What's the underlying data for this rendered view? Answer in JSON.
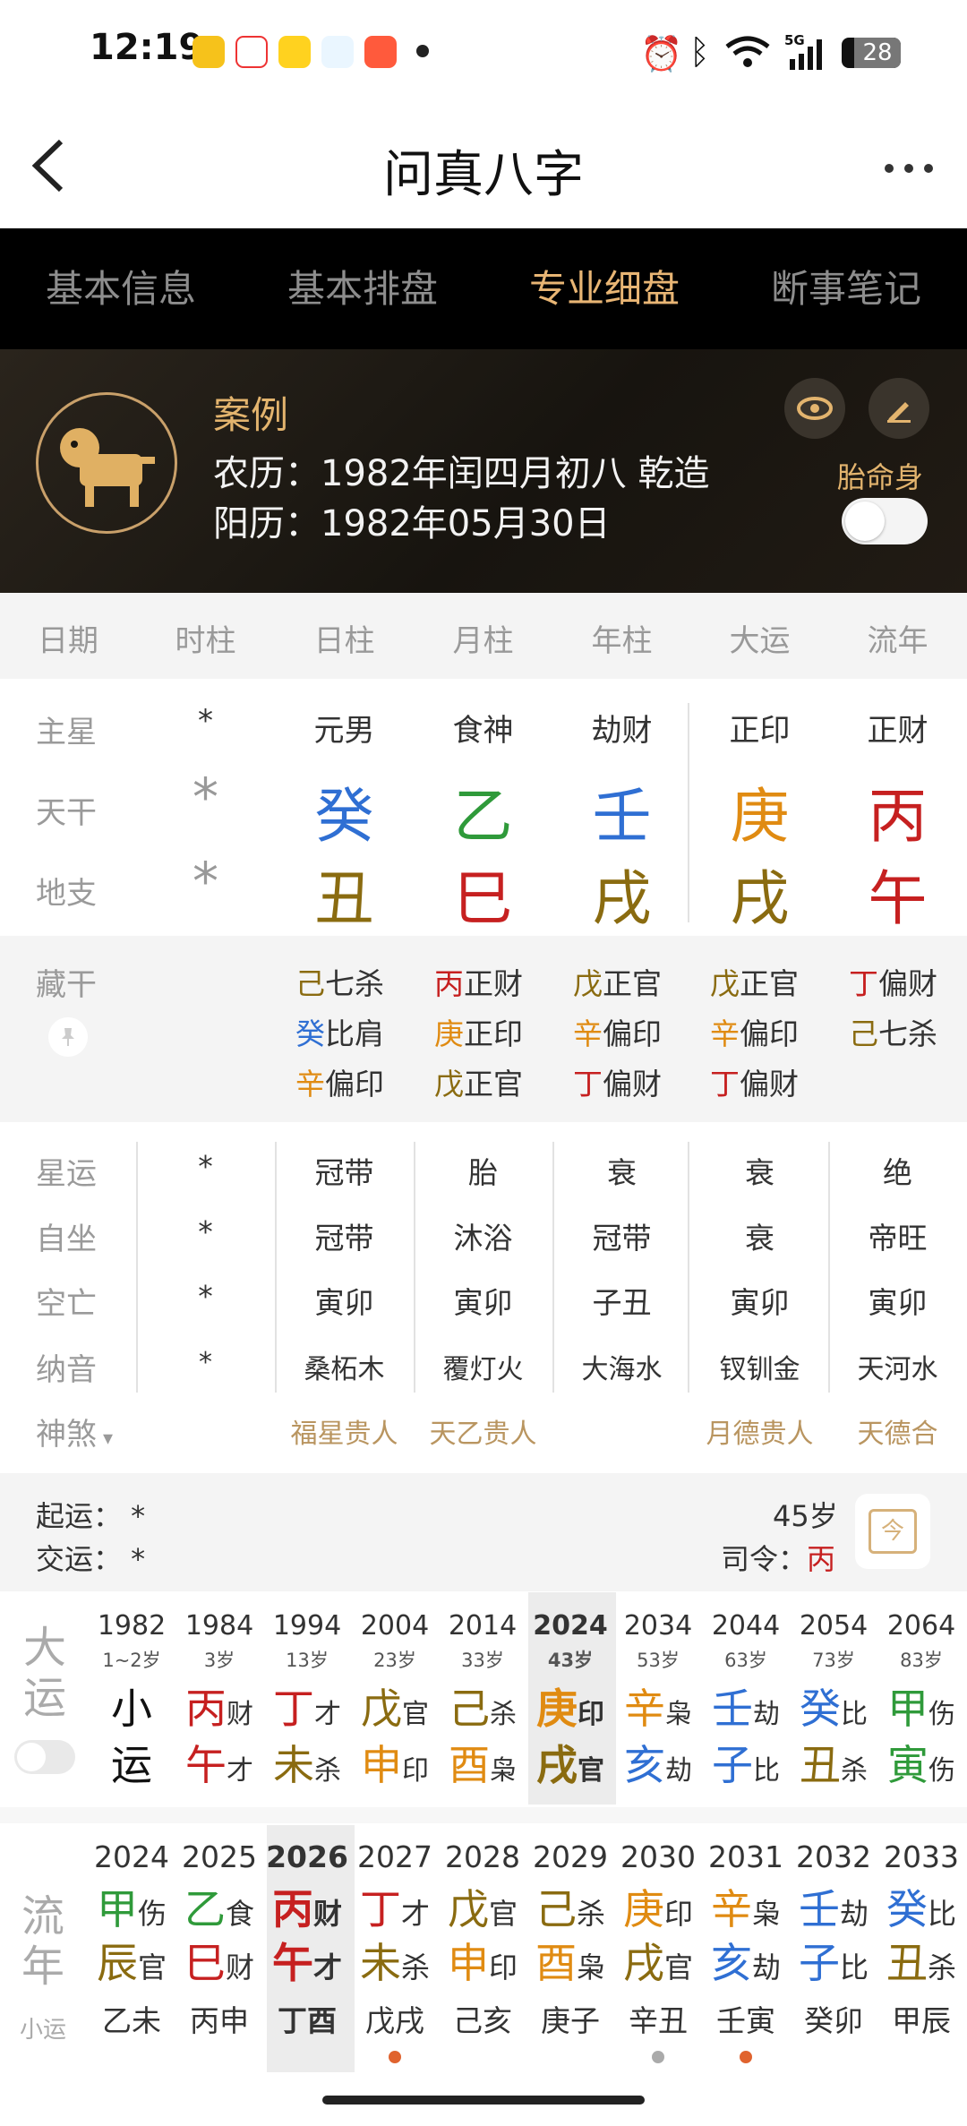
{
  "status_bar": {
    "time": "12:19",
    "battery": "28",
    "network": "5G"
  },
  "header": {
    "title": "问真八字",
    "back_icon": "chevron-left-icon",
    "more_icon": "more-icon"
  },
  "tabs": [
    "基本信息",
    "基本排盘",
    "专业细盘",
    "断事笔记"
  ],
  "active_tab": 2,
  "profile": {
    "name": "案例",
    "lunar": "农历：1982年闰四月初八 乾造",
    "solar": "阳历：1982年05月30日",
    "taiming_label": "胎命身",
    "taiming_on": false
  },
  "grid": {
    "headers": [
      "日期",
      "时柱",
      "日柱",
      "月柱",
      "年柱",
      "大运",
      "流年"
    ],
    "rows": {
      "zhuxing": {
        "label": "主星",
        "values": [
          "*",
          "元男",
          "食神",
          "劫财",
          "正印",
          "正财"
        ]
      },
      "tiangan": {
        "label": "天干",
        "values": [
          "*",
          "癸",
          "乙",
          "壬",
          "庚",
          "丙"
        ]
      },
      "dizhi": {
        "label": "地支",
        "values": [
          "*",
          "丑",
          "巳",
          "戌",
          "戌",
          "午"
        ]
      }
    }
  },
  "canggan": {
    "label": "藏干",
    "columns": [
      [
        {
          "g": "己",
          "t": "七杀"
        },
        {
          "g": "癸",
          "t": "比肩"
        },
        {
          "g": "辛",
          "t": "偏印"
        }
      ],
      [
        {
          "g": "丙",
          "t": "正财"
        },
        {
          "g": "庚",
          "t": "正印"
        },
        {
          "g": "戊",
          "t": "正官"
        }
      ],
      [
        {
          "g": "戊",
          "t": "正官"
        },
        {
          "g": "辛",
          "t": "偏印"
        },
        {
          "g": "丁",
          "t": "偏财"
        }
      ],
      [
        {
          "g": "戊",
          "t": "正官"
        },
        {
          "g": "辛",
          "t": "偏印"
        },
        {
          "g": "丁",
          "t": "偏财"
        }
      ],
      [
        {
          "g": "丁",
          "t": "偏财"
        },
        {
          "g": "己",
          "t": "七杀"
        }
      ]
    ]
  },
  "details": {
    "xingyun": {
      "label": "星运",
      "values": [
        "*",
        "冠带",
        "胎",
        "衰",
        "衰",
        "绝"
      ]
    },
    "zizuo": {
      "label": "自坐",
      "values": [
        "*",
        "冠带",
        "沐浴",
        "冠带",
        "衰",
        "帝旺"
      ]
    },
    "kongwang": {
      "label": "空亡",
      "values": [
        "*",
        "寅卯",
        "寅卯",
        "子丑",
        "寅卯",
        "寅卯"
      ]
    },
    "nayin": {
      "label": "纳音",
      "values": [
        "*",
        "桑柘木",
        "覆灯火",
        "大海水",
        "钗钏金",
        "天河水"
      ]
    },
    "shensha": {
      "label": "神煞",
      "values": [
        "",
        "福星贵人",
        "天乙贵人",
        "",
        "月德贵人",
        "天德合"
      ]
    }
  },
  "qiyun": {
    "start": "起运：  *",
    "jiao": "交运：  *",
    "age": "45岁",
    "siling_label": "司令：",
    "siling_value": "丙",
    "calendar_icon": "calendar-today-icon",
    "calendar_text": "今"
  },
  "dayun": {
    "label_top": "大",
    "label_bottom": "运",
    "items": [
      {
        "year": "1982",
        "age": "1~2岁",
        "top": "小",
        "top_t": "",
        "bottom": "运",
        "bottom_t": ""
      },
      {
        "year": "1984",
        "age": "3岁",
        "top": "丙",
        "top_t": "财",
        "bottom": "午",
        "bottom_t": "才"
      },
      {
        "year": "1994",
        "age": "13岁",
        "top": "丁",
        "top_t": "才",
        "bottom": "未",
        "bottom_t": "杀"
      },
      {
        "year": "2004",
        "age": "23岁",
        "top": "戊",
        "top_t": "官",
        "bottom": "申",
        "bottom_t": "印"
      },
      {
        "year": "2014",
        "age": "33岁",
        "top": "己",
        "top_t": "杀",
        "bottom": "酉",
        "bottom_t": "枭"
      },
      {
        "year": "2024",
        "age": "43岁",
        "top": "庚",
        "top_t": "印",
        "bottom": "戌",
        "bottom_t": "官"
      },
      {
        "year": "2034",
        "age": "53岁",
        "top": "辛",
        "top_t": "枭",
        "bottom": "亥",
        "bottom_t": "劫"
      },
      {
        "year": "2044",
        "age": "63岁",
        "top": "壬",
        "top_t": "劫",
        "bottom": "子",
        "bottom_t": "比"
      },
      {
        "year": "2054",
        "age": "73岁",
        "top": "癸",
        "top_t": "比",
        "bottom": "丑",
        "bottom_t": "杀"
      },
      {
        "year": "2064",
        "age": "83岁",
        "top": "甲",
        "top_t": "伤",
        "bottom": "寅",
        "bottom_t": "伤"
      }
    ]
  },
  "liunian": {
    "label_top": "流",
    "label_bottom": "年",
    "xiaoyun_label": "小运",
    "items": [
      {
        "year": "2024",
        "top": "甲",
        "top_t": "伤",
        "mid": "辰",
        "mid_t": "官",
        "xy": "乙未"
      },
      {
        "year": "2025",
        "top": "乙",
        "top_t": "食",
        "mid": "巳",
        "mid_t": "财",
        "xy": "丙申"
      },
      {
        "year": "2026",
        "top": "丙",
        "top_t": "财",
        "mid": "午",
        "mid_t": "才",
        "xy": "丁酉"
      },
      {
        "year": "2027",
        "top": "丁",
        "top_t": "才",
        "mid": "未",
        "mid_t": "杀",
        "xy": "戊戌"
      },
      {
        "year": "2028",
        "top": "戊",
        "top_t": "官",
        "mid": "申",
        "mid_t": "印",
        "xy": "己亥"
      },
      {
        "year": "2029",
        "top": "己",
        "top_t": "杀",
        "mid": "酉",
        "mid_t": "枭",
        "xy": "庚子"
      },
      {
        "year": "2030",
        "top": "庚",
        "top_t": "印",
        "mid": "戌",
        "mid_t": "官",
        "xy": "辛丑"
      },
      {
        "year": "2031",
        "top": "辛",
        "top_t": "枭",
        "mid": "亥",
        "mid_t": "劫",
        "xy": "壬寅"
      },
      {
        "year": "2032",
        "top": "壬",
        "top_t": "劫",
        "mid": "子",
        "mid_t": "比",
        "xy": "癸卯"
      },
      {
        "year": "2033",
        "top": "癸",
        "top_t": "比",
        "mid": "丑",
        "mid_t": "杀",
        "xy": "甲辰"
      }
    ]
  },
  "colors": {
    "blue": "#2f6fd3",
    "green": "#2f9a3a",
    "red": "#c62020",
    "orange": "#e08b12",
    "brown": "#8a6b10",
    "gold": "#e3b46e"
  }
}
